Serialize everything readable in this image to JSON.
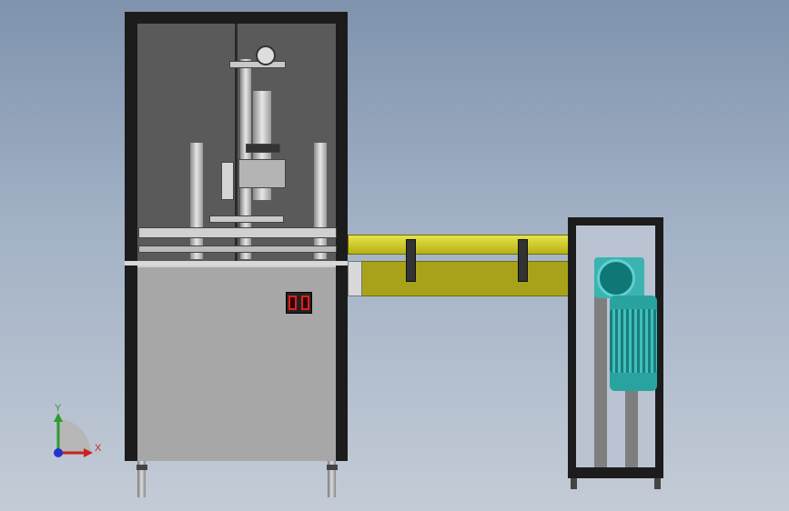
{
  "scene": {
    "axis_triad": {
      "y_label": "Y",
      "x_label": "X"
    },
    "colors": {
      "background_top": "#7f93ad",
      "background_bottom": "#c3cbd6",
      "conveyor": "#d6d22c",
      "motor": "#2aa3a0",
      "frame": "#1c1c1c"
    }
  }
}
